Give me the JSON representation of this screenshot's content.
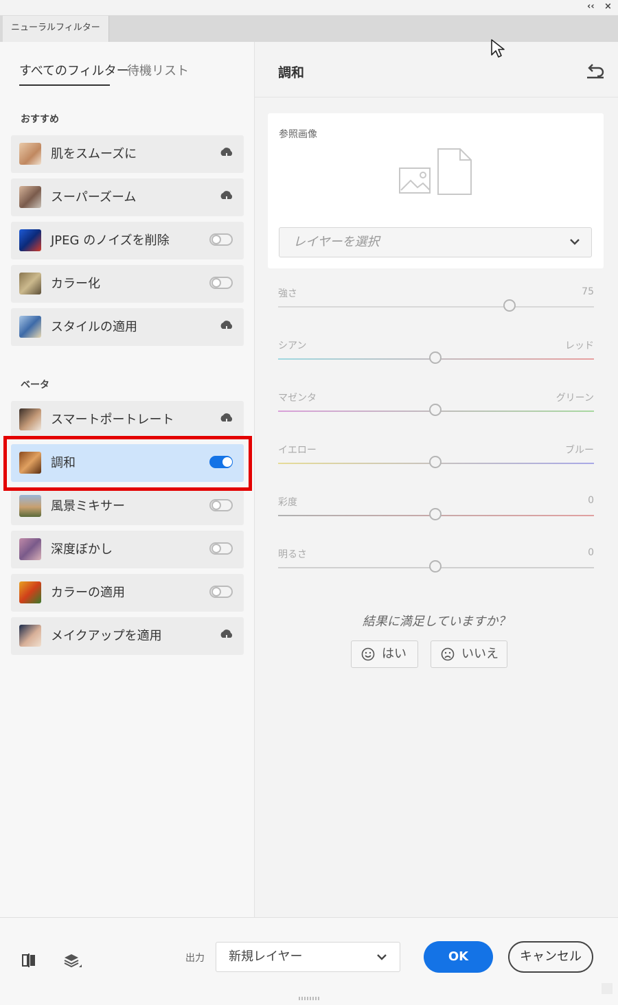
{
  "window": {
    "collapse_glyph": "‹‹",
    "close_glyph": "×",
    "panel_tab_label": "ニューラルフィルター"
  },
  "left": {
    "tabs": [
      {
        "label": "すべてのフィルター",
        "active": true
      },
      {
        "label": "待機リスト",
        "active": false
      }
    ],
    "sections": [
      {
        "label": "おすすめ",
        "items": [
          {
            "name": "肌をスムーズに",
            "control": "download",
            "icon": "portrait-smooth-skin"
          },
          {
            "name": "スーパーズーム",
            "control": "download",
            "icon": "portrait-super-zoom"
          },
          {
            "name": "JPEG のノイズを削除",
            "control": "toggle-off",
            "icon": "jpeg-artifact"
          },
          {
            "name": "カラー化",
            "control": "toggle-off",
            "icon": "colorize"
          },
          {
            "name": "スタイルの適用",
            "control": "download",
            "icon": "style-transfer"
          }
        ]
      },
      {
        "label": "ベータ",
        "items": [
          {
            "name": "スマートポートレート",
            "control": "download",
            "icon": "smart-portrait"
          },
          {
            "name": "調和",
            "control": "toggle-on",
            "selected": true,
            "icon": "harmonization"
          },
          {
            "name": "風景ミキサー",
            "control": "toggle-off",
            "icon": "landscape-mixer"
          },
          {
            "name": "深度ぼかし",
            "control": "toggle-off",
            "icon": "depth-blur"
          },
          {
            "name": "カラーの適用",
            "control": "toggle-off",
            "icon": "color-transfer"
          },
          {
            "name": "メイクアップを適用",
            "control": "download",
            "icon": "makeup-transfer"
          }
        ]
      }
    ]
  },
  "right": {
    "title": "調和",
    "reference": {
      "label": "参照画像",
      "layer_placeholder": "レイヤーを選択"
    },
    "sliders": {
      "strength": {
        "left": "強さ",
        "right": "75",
        "value": 75
      },
      "cyan_red": {
        "left": "シアン",
        "right": "レッド",
        "value": 0
      },
      "magenta_green": {
        "left": "マゼンタ",
        "right": "グリーン",
        "value": 0
      },
      "yellow_blue": {
        "left": "イエロー",
        "right": "ブルー",
        "value": 0
      },
      "saturation": {
        "left": "彩度",
        "right": "0",
        "value": 0
      },
      "brightness": {
        "left": "明るさ",
        "right": "0",
        "value": 0
      }
    },
    "feedback": {
      "question": "結果に満足していますか？",
      "yes": "はい",
      "no": "いいえ"
    }
  },
  "bottom": {
    "output_label": "出力",
    "output_value": "新規レイヤー",
    "ok": "OK",
    "cancel": "キャンセル"
  },
  "colors": {
    "accent": "#1473e6",
    "highlight": "#e30000",
    "selected_row": "#cfe4fb"
  }
}
